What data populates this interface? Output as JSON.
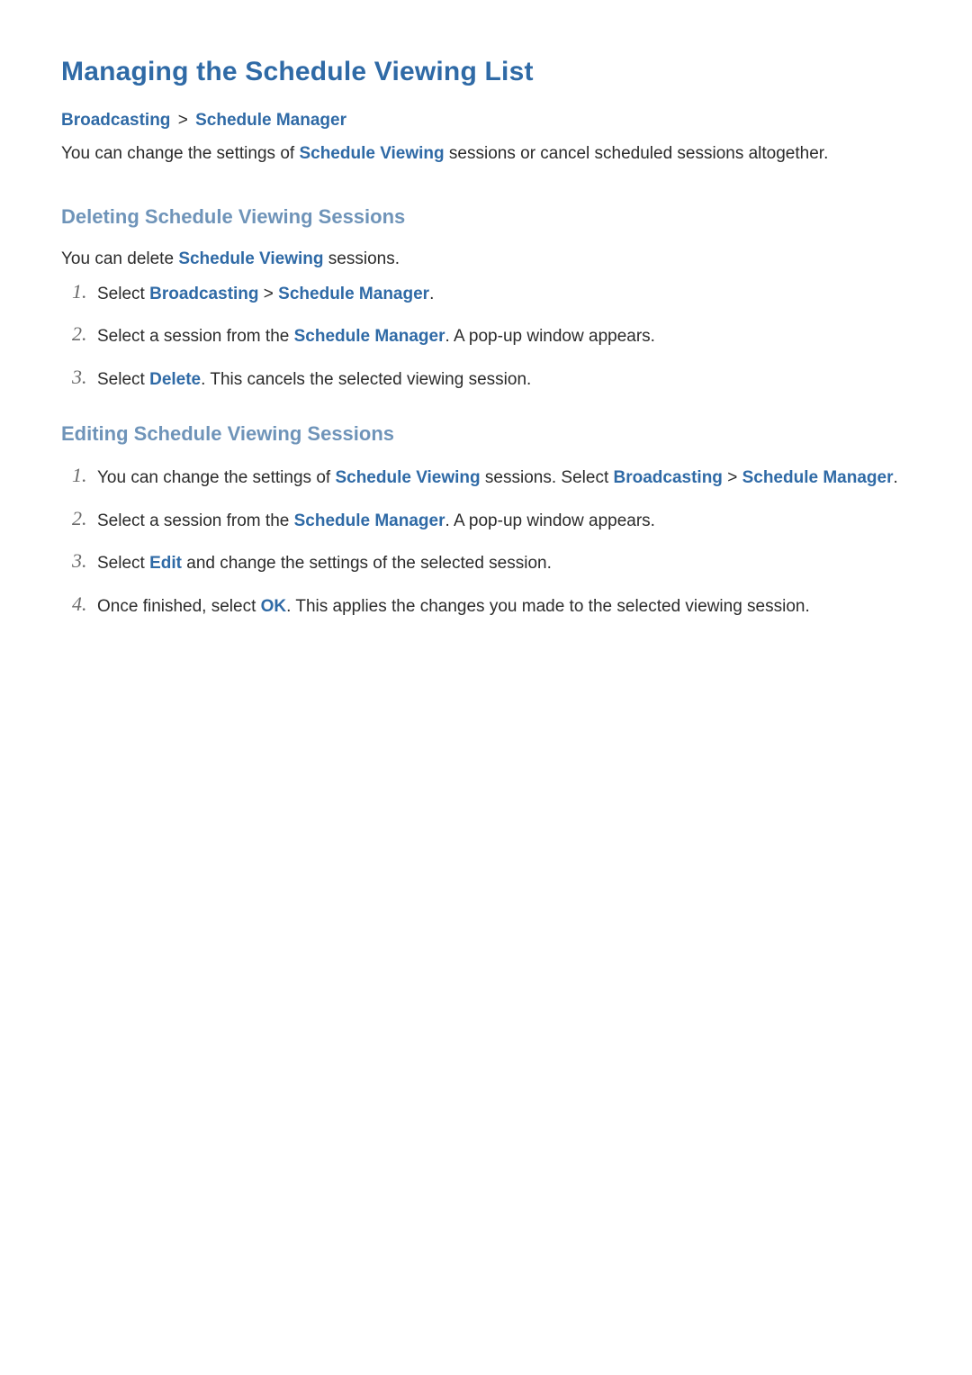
{
  "page_title": "Managing the Schedule Viewing List",
  "breadcrumb": {
    "a": "Broadcasting",
    "sep": ">",
    "b": "Schedule Manager"
  },
  "intro": {
    "pre": "You can change the settings of ",
    "kw": "Schedule Viewing",
    "post": " sessions or cancel scheduled sessions altogether."
  },
  "section_delete": {
    "title": "Deleting Schedule Viewing Sessions",
    "lead": {
      "pre": "You can delete ",
      "kw": "Schedule Viewing",
      "post": " sessions."
    },
    "steps": [
      {
        "num": "1.",
        "t1": "Select ",
        "kw1": "Broadcasting",
        "sep": " > ",
        "kw2": "Schedule Manager",
        "t2": "."
      },
      {
        "num": "2.",
        "t1": "Select a session from the ",
        "kw1": "Schedule Manager",
        "t2": ". A pop-up window appears."
      },
      {
        "num": "3.",
        "t1": "Select ",
        "kw1": "Delete",
        "t2": ". This cancels the selected viewing session."
      }
    ]
  },
  "section_edit": {
    "title": "Editing Schedule Viewing Sessions",
    "steps": [
      {
        "num": "1.",
        "t1": "You can change the settings of ",
        "kw1": "Schedule Viewing",
        "t2": " sessions. Select ",
        "kw2": "Broadcasting",
        "sep": " > ",
        "kw3": "Schedule Manager",
        "t3": "."
      },
      {
        "num": "2.",
        "t1": "Select a session from the ",
        "kw1": "Schedule Manager",
        "t2": ". A pop-up window appears."
      },
      {
        "num": "3.",
        "t1": "Select ",
        "kw1": "Edit",
        "t2": " and change the settings of the selected session."
      },
      {
        "num": "4.",
        "t1": "Once finished, select ",
        "kw1": "OK",
        "t2": ". This applies the changes you made to the selected viewing session."
      }
    ]
  }
}
